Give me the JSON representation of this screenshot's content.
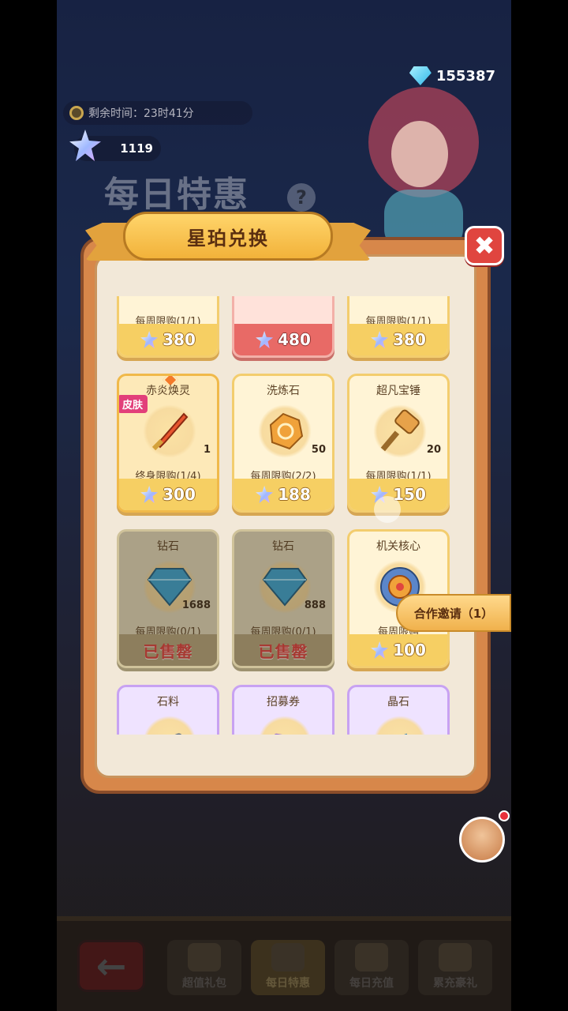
{
  "header": {
    "diamond_total": "155387",
    "timer_text": "剩余时间：23时41分",
    "star_balance": "1119",
    "background_title": "每日特惠",
    "help_symbol": "?"
  },
  "modal": {
    "title": "星珀兑换",
    "close_symbol": "✖",
    "items": [
      {
        "name": "",
        "limit": "每周限购(1/1)",
        "price": "380",
        "style": "gold"
      },
      {
        "name": "",
        "limit": "",
        "price": "480",
        "style": "pink"
      },
      {
        "name": "",
        "limit": "每周限购(1/1)",
        "price": "380",
        "style": "gold"
      },
      {
        "name": "赤炎焕灵",
        "badge": "皮肤",
        "qty": "1",
        "limit": "终身限购(1/4)",
        "price": "300",
        "style": "featured",
        "icon": "flame-sword-icon"
      },
      {
        "name": "洗炼石",
        "qty": "50",
        "limit": "每周限购(2/2)",
        "price": "188",
        "style": "gold",
        "icon": "refining-stone-icon"
      },
      {
        "name": "超凡宝锤",
        "qty": "20",
        "limit": "每周限购(1/1)",
        "price": "150",
        "style": "gold",
        "icon": "hammer-icon"
      },
      {
        "name": "钻石",
        "qty": "1688",
        "limit": "每周限购(0/1)",
        "status": "已售罄",
        "style": "sold",
        "icon": "diamond-icon"
      },
      {
        "name": "钻石",
        "qty": "888",
        "limit": "每周限购(0/1)",
        "status": "已售罄",
        "style": "sold",
        "icon": "diamond-icon"
      },
      {
        "name": "机关核心",
        "qty": "",
        "limit": "每周限购",
        "price": "100",
        "style": "gold",
        "icon": "mech-core-icon"
      },
      {
        "name": "石料",
        "style": "purple",
        "icon": "stone-icon"
      },
      {
        "name": "招募券",
        "style": "purple",
        "icon": "ticket-icon"
      },
      {
        "name": "晶石",
        "style": "purple",
        "icon": "crystal-icon"
      }
    ]
  },
  "invite": {
    "label": "合作邀请（1）"
  },
  "bottom_tabs": [
    {
      "label": "超值礼包"
    },
    {
      "label": "每日特惠"
    },
    {
      "label": "每日充值"
    },
    {
      "label": "累充豪礼"
    }
  ],
  "colors": {
    "accent_gold": "#f6cf63",
    "sold_red": "#e03c3c",
    "close_red": "#e0453f"
  }
}
